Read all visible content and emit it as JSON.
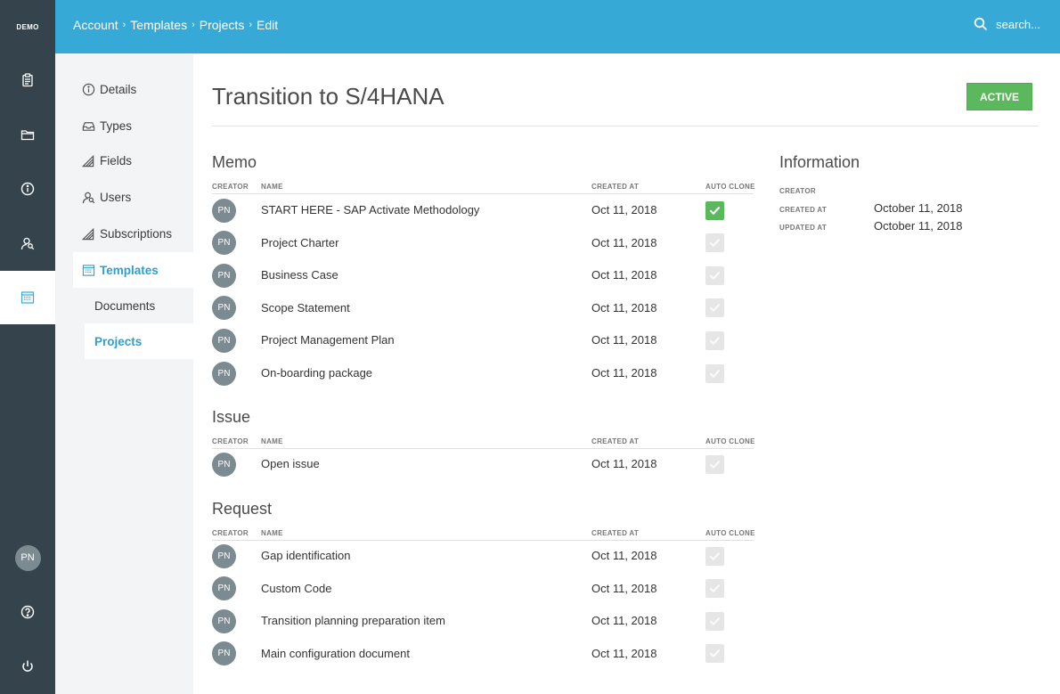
{
  "rail": {
    "logo": "DEMO",
    "avatar": "PN"
  },
  "breadcrumb": [
    "Account",
    "Templates",
    "Projects",
    "Edit"
  ],
  "search": {
    "placeholder": "search..."
  },
  "subnav": {
    "items": [
      "Details",
      "Types",
      "Fields",
      "Users",
      "Subscriptions",
      "Templates"
    ],
    "children": [
      "Documents",
      "Projects"
    ]
  },
  "page": {
    "title": "Transition to S/4HANA",
    "status": "ACTIVE"
  },
  "columns": {
    "creator": "CREATOR",
    "name": "NAME",
    "created_at": "CREATED AT",
    "auto_clone": "AUTO CLONE"
  },
  "sections": {
    "memo": {
      "title": "Memo",
      "rows": [
        {
          "creator": "PN",
          "name": "START HERE - SAP Activate Methodology",
          "created_at": "Oct 11, 2018",
          "auto_clone": true
        },
        {
          "creator": "PN",
          "name": "Project Charter",
          "created_at": "Oct 11, 2018",
          "auto_clone": false
        },
        {
          "creator": "PN",
          "name": "Business Case",
          "created_at": "Oct 11, 2018",
          "auto_clone": false
        },
        {
          "creator": "PN",
          "name": "Scope Statement",
          "created_at": "Oct 11, 2018",
          "auto_clone": false
        },
        {
          "creator": "PN",
          "name": "Project Management Plan",
          "created_at": "Oct 11, 2018",
          "auto_clone": false
        },
        {
          "creator": "PN",
          "name": "On-boarding package",
          "created_at": "Oct 11, 2018",
          "auto_clone": false
        }
      ]
    },
    "issue": {
      "title": "Issue",
      "rows": [
        {
          "creator": "PN",
          "name": "Open issue",
          "created_at": "Oct 11, 2018",
          "auto_clone": false
        }
      ]
    },
    "request": {
      "title": "Request",
      "rows": [
        {
          "creator": "PN",
          "name": "Gap identification",
          "created_at": "Oct 11, 2018",
          "auto_clone": false
        },
        {
          "creator": "PN",
          "name": "Custom Code",
          "created_at": "Oct 11, 2018",
          "auto_clone": false
        },
        {
          "creator": "PN",
          "name": "Transition planning preparation item",
          "created_at": "Oct 11, 2018",
          "auto_clone": false
        },
        {
          "creator": "PN",
          "name": "Main configuration document",
          "created_at": "Oct 11, 2018",
          "auto_clone": false
        }
      ]
    }
  },
  "information": {
    "title": "Information",
    "creator_label": "CREATOR",
    "created_label": "CREATED AT",
    "created_value": "October 11, 2018",
    "updated_label": "UPDATED AT",
    "updated_value": "October 11, 2018"
  },
  "colors": {
    "accent": "#37a9d6",
    "rail": "#34434c",
    "active": "#5cb85c",
    "link": "#2f9fcf"
  }
}
